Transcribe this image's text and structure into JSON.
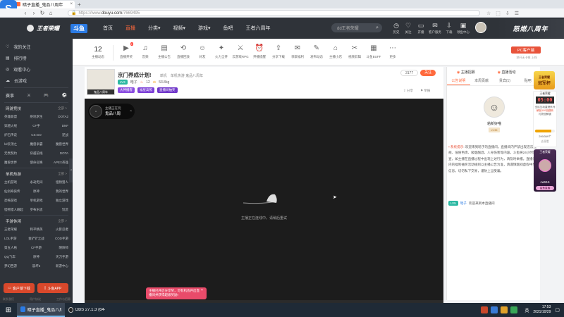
{
  "browser": {
    "tab_title": "暗子直播_鬼品八周年",
    "url_prefix": "https://www.",
    "url_domain": "douyu.com",
    "url_path": "/7669495",
    "tab_close": "×",
    "logo_glyph": "S"
  },
  "header": {
    "logo_text": "王者荣耀",
    "logo2": "斗鱼",
    "nav": [
      "首页",
      "直播",
      "分类",
      "视频",
      "游戏",
      "鱼吧",
      "王者六周年"
    ],
    "nav_arrows": [
      "",
      "",
      "▾",
      "▾",
      "▾",
      "",
      ""
    ],
    "search_placeholder": "dd王者荣耀",
    "icons": [
      {
        "name": "history-icon",
        "label": "历史"
      },
      {
        "name": "follow-icon",
        "label": "关注"
      },
      {
        "name": "live-icon",
        "label": "开播"
      },
      {
        "name": "message-icon",
        "label": "客户服务"
      },
      {
        "name": "download-icon",
        "label": "下载"
      },
      {
        "name": "mail-icon",
        "label": "领鱼中心"
      }
    ],
    "banner_text": "怒燃八周年"
  },
  "sidebar": {
    "top_items": [
      "我的关注",
      "排行榜",
      "观看中心",
      "云游戏"
    ],
    "hot_icons": [
      "赛事",
      "⚔",
      "🎮",
      "⚽"
    ],
    "sections": [
      {
        "title": "网游竞技",
        "more": "全部 >",
        "items": [
          "英雄联盟",
          "绝地求生",
          "DOTA2",
          "穿越火线",
          "CF手",
          "DNF",
          "炉石传说",
          "CS:GO",
          "逆战",
          "lol云顶之",
          "魔兽争霸",
          "魔兽世界",
          "无畏契约",
          "穿越前线",
          "DOTA",
          "魔兽世界",
          "使命召唤",
          "APEX英雄"
        ]
      },
      {
        "title": "单机热游",
        "more": "全部 >",
        "items": [
          "主机游戏",
          "永劫无间",
          "怪物猎人",
          "仙剑奇侠传",
          "原神",
          "我的世界",
          "恐怖游戏",
          "单机游戏",
          "独立游戏",
          "怪物猎人崛起",
          "罗布乐思",
          "饥荒"
        ]
      },
      {
        "title": "手游休闲",
        "more": "全部 >",
        "items": [
          "王者荣耀",
          "和平精英",
          "火影忍者",
          "LOL手游",
          "金铲铲之战",
          "COD手游",
          "第五人格",
          "CF手游",
          "阴阳师",
          "QQ飞车",
          "原神",
          "天刀手游",
          "梦幻西游",
          "崩坏3",
          "新游中心"
        ]
      }
    ],
    "btn_client": "客户端下载",
    "btn_app": "斗鱼APP",
    "footer": [
      "联系我们",
      "用户协议",
      "工作与招募"
    ]
  },
  "catbar": {
    "subscribe_count": "12",
    "subscribe_label": "主播动态",
    "items": [
      {
        "name": "live-room-icon",
        "label": "直播开奖",
        "badge": "2"
      },
      {
        "name": "audio-icon",
        "label": "音频"
      },
      {
        "name": "notice-icon",
        "label": "主播公告"
      },
      {
        "name": "replay-icon",
        "label": "直播回放"
      },
      {
        "name": "friend-icon",
        "label": "好友"
      },
      {
        "name": "fleet-icon",
        "label": "火力全开"
      },
      {
        "name": "rpg-icon",
        "label": "云游戏RPG"
      },
      {
        "name": "treasure-icon",
        "label": "开播提醒"
      },
      {
        "name": "share-icon",
        "label": "分享下载"
      },
      {
        "name": "chest-icon",
        "label": "领取福利"
      },
      {
        "name": "note-icon",
        "label": "发布动态"
      },
      {
        "name": "shop-icon",
        "label": "主播小店"
      },
      {
        "name": "rank-icon",
        "label": "视频剪辑"
      },
      {
        "name": "pk-icon",
        "label": "斗鱼BUFF"
      },
      {
        "name": "more-icon",
        "label": "更多"
      }
    ],
    "pc_client_btn": "PC客户端",
    "pc_client_sub": "秒开无卡顿 上线"
  },
  "room": {
    "title": "京门养成计划!",
    "category_prefix": "单机",
    "category": "单机热游 鬼品八周年",
    "level_badge": "LV3",
    "streamer": "暗子",
    "heat_label": "12",
    "weight": "53.8kg",
    "tags": [
      "大神播客",
      "福星高照",
      "直播间抽奖"
    ],
    "follow_count": "3177",
    "follow_btn": "关注",
    "share_label": "分享",
    "report_label": "举报",
    "avatar_caption": "鬼品八周年",
    "avatar_sub": "鬼品八周"
  },
  "video": {
    "overlay_title": "主播正在玩",
    "overlay_game": "鬼品八周",
    "status_text": "主播正在连线中，请稍后重试",
    "toast_text": "主播已开启分享奖，可有机会开启直播间并获得超级奖励!",
    "toast_close": "×"
  },
  "panel": {
    "tabs_top": [
      "主播招募",
      "直播活动"
    ],
    "tabs": [
      "公告说明",
      "本周贡献",
      "贵宾(1)",
      "贴吧"
    ],
    "username": "粘新好喵",
    "user_level": "LV35",
    "notice_label": "系统提示",
    "notice_text": "欢迎来到暗子的直播间。直播间内严禁出现违法违规、低俗色情、吸烟酗酒、人身伤害等内容，斗鱼将24小时巡查，如主播在直播过程中出现上述行为，请及时举报。直播间内的福利抽奖活动规则以主播公告为准，请谨慎甄别虚假中奖信息，切勿私下交易，谨防上当受骗。",
    "chat_level": "LV5",
    "chat_user": "暗子",
    "chat_text": "欢迎来到本直播间"
  },
  "ads": {
    "ad1_top": "王者荣耀",
    "ad1_title": "冠军杯",
    "ad1_timer": "05:00",
    "ad1_sub1": "全民互动重燃系列",
    "ad1_sub2": "解锁100色翻转",
    "ad1_sub3": "礼物全解锁",
    "ad1_progress": "299/369个",
    "ad1_progress_fraction": 0.81,
    "ad1_btn": "去观看",
    "ad2_top": "王者荣耀",
    "ad2_name": "cw515",
    "ad2_btn": "鲨鱼直播"
  },
  "taskbar": {
    "start": "⊞",
    "apps": [
      "暗子直播_鬼品八周年",
      "OBS 27.1.3 (64-bit)..."
    ],
    "time": "17:53",
    "date": "2021/10/29",
    "tray_text": "英"
  },
  "colors": {
    "accent": "#ff6a3d",
    "header_bg": "#2f3339",
    "purple_tag": "#8a4de0",
    "teal_tag": "#2bb8a2"
  }
}
